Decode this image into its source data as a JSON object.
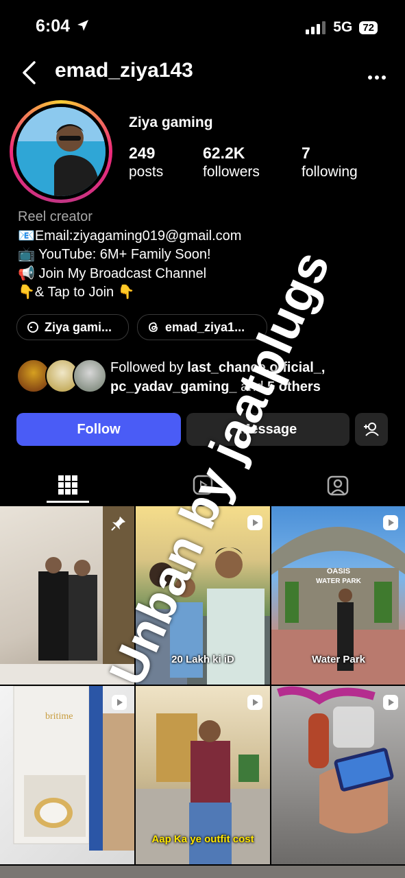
{
  "status_bar": {
    "time": "6:04",
    "network": "5G",
    "battery": "72"
  },
  "header": {
    "username": "emad_ziya143"
  },
  "profile": {
    "name": "Ziya gaming",
    "stats": [
      {
        "value": "249",
        "label": "posts"
      },
      {
        "value": "62.2K",
        "label": "followers"
      },
      {
        "value": "7",
        "label": "following"
      }
    ],
    "category": "Reel creator",
    "bio_lines": [
      "📧Email:ziyagaming019@gmail.com",
      "📺 YouTube: 6M+ Family Soon!",
      "📢 Join My Broadcast Channel",
      "👇& Tap to Join 👇"
    ],
    "links": [
      {
        "label": "Ziya gami..."
      },
      {
        "label": "emad_ziya1..."
      }
    ],
    "followed_by": {
      "prefix": "Followed by ",
      "user1": "last_chance.official_,",
      "user2": "pc_yadav_gaming_",
      "middle": " and ",
      "others": "5 others"
    }
  },
  "actions": {
    "follow": "Follow",
    "message": "Message"
  },
  "tabs": [
    "grid-icon",
    "reels-icon",
    "tagged-icon"
  ],
  "grid": [
    {
      "caption": "",
      "type": "pinned"
    },
    {
      "caption": "20 Lakh ki iD",
      "type": "reel"
    },
    {
      "caption": "Water Park",
      "type": "reel",
      "sign": "OASIS WATER PARK"
    },
    {
      "caption": "",
      "type": "reel",
      "brand": "britime"
    },
    {
      "caption": "Aap Ka ye outfit cost",
      "type": "reel"
    },
    {
      "caption": "",
      "type": "reel"
    }
  ],
  "watermark": "Unban by jaatplugs",
  "colors": {
    "follow_button": "#4a5cf6",
    "secondary_button": "#262626",
    "background": "#000000"
  }
}
